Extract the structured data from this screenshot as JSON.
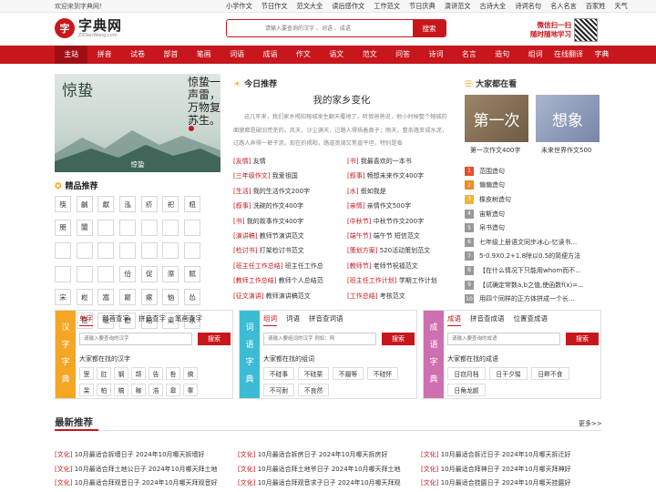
{
  "topbar": {
    "welcome": "欢迎来到字典网！",
    "links": [
      "小学作文",
      "节日作文",
      "范文大全",
      "读后感作文",
      "工作范文",
      "节日庆典",
      "演讲范文",
      "古诗大全",
      "诗词名句",
      "名人名言",
      "百家姓",
      "天气"
    ]
  },
  "header": {
    "logo_name": "字典网",
    "logo_domain": "ZiDianWang.com",
    "search_placeholder": "请输入要查询的汉字 、词语 、成语",
    "search_button": "搜索",
    "qr_line1": "微信扫一扫",
    "qr_line2": "随时随地学习"
  },
  "mainnav": [
    "主站",
    "拼音",
    "试卷",
    "部首",
    "笔画",
    "词语",
    "成语",
    "作文",
    "语文",
    "范文",
    "问答",
    "诗词",
    "名言",
    "造句",
    "组词",
    "在线翻译",
    "字典"
  ],
  "banner": {
    "left_text": "惊蛰",
    "poem": "惊蛰一声雷，万物复苏生。",
    "caption": "惊蛰"
  },
  "hot_chars": {
    "title": "精品推荐",
    "chars": [
      "筷",
      "鹹",
      "獻",
      "泓",
      "疥",
      "祀",
      "粈",
      "朋",
      "闟",
      "",
      "",
      "",
      "",
      "",
      "",
      "",
      "",
      "",
      "",
      "",
      "",
      "",
      "",
      "",
      "佮",
      "促",
      "漈",
      "赋",
      "宋",
      "崧",
      "嵩",
      "巅",
      "瘃",
      "恼",
      "怂",
      "倲",
      "惬",
      "惗",
      "懋",
      "柗",
      "粢",
      "氶",
      "枍",
      "寀"
    ]
  },
  "today": {
    "title": "今日推荐",
    "article_title": "我的家乡变化",
    "article_body": "这几年来，我们家乡揭阳榕城发生翻天覆地了。听我爸爸说，他小时候整个榕城的面貌都是破旧荒芜的。风天，沙尘满天，过路人得捂着鼻子；雨天，整条路变成水泥，过路人弄得一裤子泥。现在的揭阳，路道宽阔又笔直平坦，特别是临",
    "links": [
      {
        "tag": "[友情]",
        "text": "友情"
      },
      {
        "tag": "[书]",
        "text": "我最喜欢的一本书"
      },
      {
        "tag": "[三年级作文]",
        "text": "我爱祖国"
      },
      {
        "tag": "[叙事]",
        "text": "畅想未来作文400字"
      },
      {
        "tag": "[生活]",
        "text": "我的生活作文200字"
      },
      {
        "tag": "[水]",
        "text": "假如我是"
      },
      {
        "tag": "[叙事]",
        "text": "洗碗的作文400字"
      },
      {
        "tag": "[亲情]",
        "text": "亲情作文500字"
      },
      {
        "tag": "[书]",
        "text": "我的故事作文400字"
      },
      {
        "tag": "[中秋节]",
        "text": "中秋节作文200字"
      },
      {
        "tag": "[演讲稿]",
        "text": "教师节演讲范文"
      },
      {
        "tag": "[端午节]",
        "text": "端午节 短信范文"
      },
      {
        "tag": "[检讨书]",
        "text": "打架检讨书范文"
      },
      {
        "tag": "[策划方案]",
        "text": "520活动策划范文"
      },
      {
        "tag": "[班主任工作总结]",
        "text": "班主任工作总"
      },
      {
        "tag": "[教师节]",
        "text": "老师节祝福范文"
      },
      {
        "tag": "[教师工作总结]",
        "text": "教师个人总结范"
      },
      {
        "tag": "[班主任工作计划]",
        "text": "学期工作计划"
      },
      {
        "tag": "[征文演讲]",
        "text": "教师演讲稿范文"
      },
      {
        "tag": "[工作总结]",
        "text": "考核范文"
      }
    ]
  },
  "hot_reading": {
    "title": "大家都在看",
    "book1_cover": "第一次",
    "book1_caption": "第一次作文400字",
    "book2_cover": "想象",
    "book2_caption": "未来世界作文500",
    "ranks": [
      "1",
      "2",
      "3",
      "4",
      "5",
      "6",
      "7",
      "8",
      "9",
      "10"
    ],
    "list": [
      "范围造句",
      "偏偏造句",
      "橡皮树造句",
      "宙斯造句",
      "帛书造句",
      "七年级上册语文同步冰心-忆读书...",
      "5-0.9X0.2+1.8除以0.5的简便方法",
      "【在什么情况下只能用whom而不...",
      "【试确定常数a,b之值,使函数f(x)=...",
      "用四个同样的正方体拼成一个长..."
    ]
  },
  "dict_hanzi": {
    "side": [
      "汉",
      "字",
      "字",
      "典"
    ],
    "tabs": [
      "单字",
      "部首查字",
      "拼音查字",
      "笔画查字"
    ],
    "placeholder": "请输入要查询的汉字",
    "button": "搜索",
    "label": "大家都在找的汉字",
    "items": [
      "罡",
      "肛",
      "钢",
      "颉",
      "告",
      "咎",
      "搞",
      "杲",
      "柏",
      "槁",
      "稼",
      "浩",
      "皋",
      "睾",
      "槁",
      "篙"
    ]
  },
  "dict_ciyu": {
    "side": [
      "词",
      "语",
      "字",
      "典"
    ],
    "tabs": [
      "组词",
      "词语",
      "拼音查词语"
    ],
    "placeholder": "请输入要组词的汉字 例如：阿",
    "button": "搜索",
    "label": "大家都在找的组词",
    "items": [
      "不硅事",
      "不硅栗",
      "不蹑等",
      "不硅怀",
      "不可耐",
      "不良然"
    ]
  },
  "dict_chengyu": {
    "side": [
      "成",
      "语",
      "字",
      "典"
    ],
    "tabs": [
      "成语",
      "拼音查成语",
      "位置查成语"
    ],
    "placeholder": "请输入要查询的成语",
    "button": "搜索",
    "label": "大家都在找的成语",
    "items": [
      "日窃月档",
      "日干夕惕",
      "日畔不食",
      "日角龙颜"
    ]
  },
  "latest": {
    "title": "最新推荐",
    "more": "更多>>",
    "items": [
      {
        "tag": "[文化]",
        "text": "10月最适合拆墙日子 2024年10月哪天拆墙好"
      },
      {
        "tag": "[文化]",
        "text": "10月最适合拆房日子 2024年10月哪天拆房好"
      },
      {
        "tag": "[文化]",
        "text": "10月最适合拆迁日子 2024年10月哪天拆迁好"
      },
      {
        "tag": "[文化]",
        "text": "10月最适合拜土地公日子 2024年10月哪天拜土地"
      },
      {
        "tag": "[文化]",
        "text": "10月最适合拜土地爷日子 2024年10月哪天拜土地"
      },
      {
        "tag": "[文化]",
        "text": "10月最适合拜神日子 2024年10月哪天拜神好"
      },
      {
        "tag": "[文化]",
        "text": "10月最适合拜观音日子 2024年10月哪天拜观音好"
      },
      {
        "tag": "[文化]",
        "text": "10月最适合拜观音求子日子 2024年10月哪天拜观"
      },
      {
        "tag": "[文化]",
        "text": "10月最适合挂匾日子 2024年10月哪天挂匾好"
      }
    ]
  }
}
